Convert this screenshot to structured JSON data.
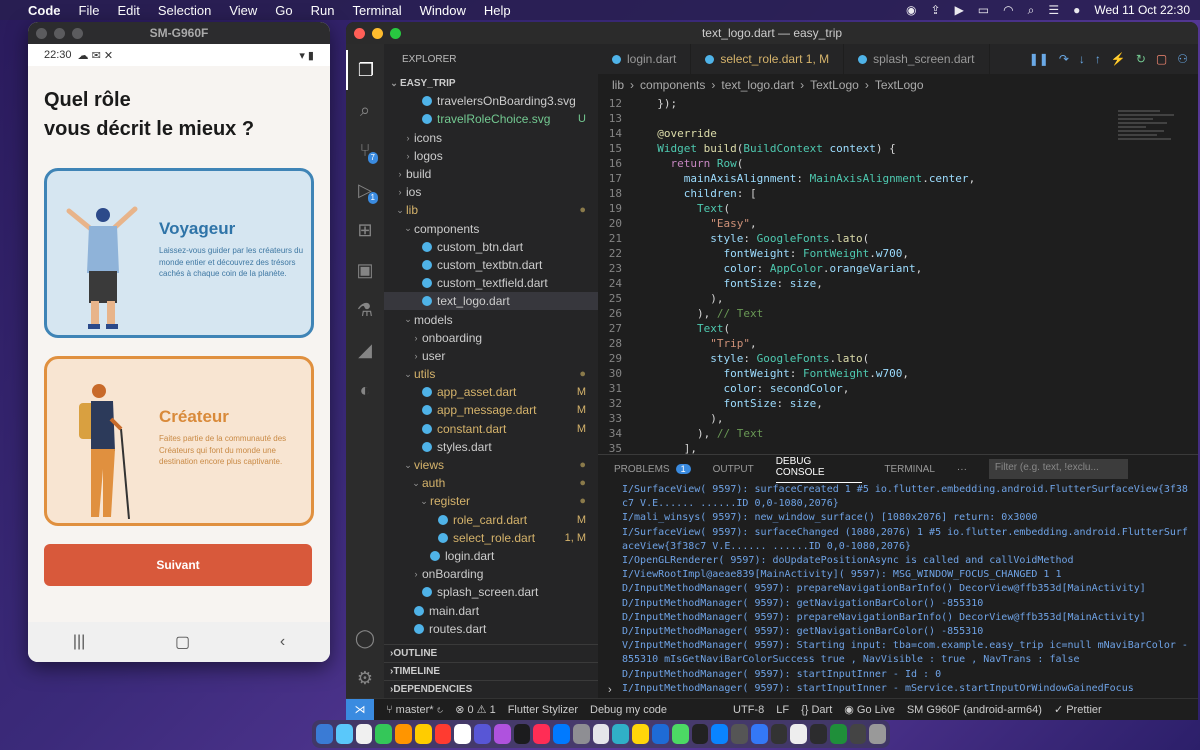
{
  "menubar": {
    "apple": "",
    "app": "Code",
    "items": [
      "File",
      "Edit",
      "Selection",
      "View",
      "Go",
      "Run",
      "Terminal",
      "Window",
      "Help"
    ],
    "clock": "Wed 11 Oct  22:30"
  },
  "phone": {
    "window_title": "SM-G960F",
    "status_time": "22:30",
    "status_icons": "☁ ✉ ✕",
    "status_right": "▾ ▮",
    "heading_line1": "Quel rôle",
    "heading_line2": "vous décrit le mieux ?",
    "card1": {
      "title": "Voyageur",
      "desc": "Laissez-vous guider par les créateurs du monde entier et découvrez des trésors cachés à chaque coin de la planète."
    },
    "card2": {
      "title": "Créateur",
      "desc": "Faites partie de la communauté des Créateurs qui font du monde une destination encore plus captivante."
    },
    "next_button": "Suivant",
    "nav": {
      "recents": "|||",
      "home": "▢",
      "back": "‹"
    }
  },
  "vscode": {
    "window_title": "text_logo.dart — easy_trip",
    "activity_badges": {
      "scm": "7",
      "debug": "1"
    },
    "explorer": {
      "header": "EXPLORER",
      "root": "EASY_TRIP",
      "tree": [
        {
          "label": "travelersOnBoarding3.svg",
          "indent": 2,
          "type": "file",
          "status": ""
        },
        {
          "label": "travelRoleChoice.svg",
          "indent": 2,
          "type": "file",
          "status": "U",
          "cls": "untr"
        },
        {
          "label": "icons",
          "indent": 1,
          "type": "folder",
          "status": ""
        },
        {
          "label": "logos",
          "indent": 1,
          "type": "folder",
          "status": ""
        },
        {
          "label": "build",
          "indent": 0,
          "type": "folder",
          "status": ""
        },
        {
          "label": "ios",
          "indent": 0,
          "type": "folder",
          "status": ""
        },
        {
          "label": "lib",
          "indent": 0,
          "type": "folder-open",
          "status": "●",
          "cls": "mod"
        },
        {
          "label": "components",
          "indent": 1,
          "type": "folder-open",
          "status": ""
        },
        {
          "label": "custom_btn.dart",
          "indent": 2,
          "type": "file",
          "status": ""
        },
        {
          "label": "custom_textbtn.dart",
          "indent": 2,
          "type": "file",
          "status": ""
        },
        {
          "label": "custom_textfield.dart",
          "indent": 2,
          "type": "file",
          "status": ""
        },
        {
          "label": "text_logo.dart",
          "indent": 2,
          "type": "file",
          "status": "",
          "sel": true
        },
        {
          "label": "models",
          "indent": 1,
          "type": "folder-open",
          "status": ""
        },
        {
          "label": "onboarding",
          "indent": 2,
          "type": "folder",
          "status": ""
        },
        {
          "label": "user",
          "indent": 2,
          "type": "folder",
          "status": ""
        },
        {
          "label": "utils",
          "indent": 1,
          "type": "folder-open",
          "status": "●",
          "cls": "mod"
        },
        {
          "label": "app_asset.dart",
          "indent": 2,
          "type": "file",
          "status": "M",
          "cls": "mod"
        },
        {
          "label": "app_message.dart",
          "indent": 2,
          "type": "file",
          "status": "M",
          "cls": "mod"
        },
        {
          "label": "constant.dart",
          "indent": 2,
          "type": "file",
          "status": "M",
          "cls": "mod"
        },
        {
          "label": "styles.dart",
          "indent": 2,
          "type": "file",
          "status": ""
        },
        {
          "label": "views",
          "indent": 1,
          "type": "folder-open",
          "status": "●",
          "cls": "mod"
        },
        {
          "label": "auth",
          "indent": 2,
          "type": "folder-open",
          "status": "●",
          "cls": "mod"
        },
        {
          "label": "register",
          "indent": 3,
          "type": "folder-open",
          "status": "●",
          "cls": "mod"
        },
        {
          "label": "role_card.dart",
          "indent": 4,
          "type": "file",
          "status": "M",
          "cls": "mod"
        },
        {
          "label": "select_role.dart",
          "indent": 4,
          "type": "file",
          "status": "1, M",
          "cls": "mod"
        },
        {
          "label": "login.dart",
          "indent": 3,
          "type": "file",
          "status": ""
        },
        {
          "label": "onBoarding",
          "indent": 2,
          "type": "folder",
          "status": ""
        },
        {
          "label": "splash_screen.dart",
          "indent": 2,
          "type": "file",
          "status": ""
        },
        {
          "label": "main.dart",
          "indent": 1,
          "type": "file",
          "status": ""
        },
        {
          "label": "routes.dart",
          "indent": 1,
          "type": "file",
          "status": ""
        }
      ],
      "sections": [
        "OUTLINE",
        "TIMELINE",
        "DEPENDENCIES"
      ]
    },
    "tabs": [
      {
        "label": "login.dart",
        "active": false,
        "extra": ""
      },
      {
        "label": "select_role.dart",
        "active": false,
        "extra": "1, M"
      },
      {
        "label": "splash_screen.dart",
        "active": false,
        "extra": ""
      }
    ],
    "breadcrumb": [
      "lib",
      "components",
      "text_logo.dart",
      "TextLogo",
      "TextLogo"
    ],
    "code": [
      {
        "n": "12",
        "html": "  });"
      },
      {
        "n": "13",
        "html": ""
      },
      {
        "n": "14",
        "html": "  <span class='f'>@override</span>"
      },
      {
        "n": "15",
        "html": "  <span class='ty'>Widget</span> <span class='f'>build</span>(<span class='ty'>BuildContext</span> <span class='p'>context</span>) {"
      },
      {
        "n": "16",
        "html": "    <span class='k2'>return</span> <span class='ty'>Row</span>("
      },
      {
        "n": "17",
        "html": "      <span class='p'>mainAxisAlignment</span>: <span class='ty'>MainAxisAlignment</span>.<span class='p'>center</span>,"
      },
      {
        "n": "18",
        "html": "      <span class='p'>children</span>: ["
      },
      {
        "n": "19",
        "html": "        <span class='ty'>Text</span>("
      },
      {
        "n": "20",
        "html": "          <span class='s'>\"Easy\"</span>,"
      },
      {
        "n": "21",
        "html": "          <span class='p'>style</span>: <span class='ty'>GoogleFonts</span>.<span class='f'>lato</span>("
      },
      {
        "n": "22",
        "html": "            <span class='p'>fontWeight</span>: <span class='ty'>FontWeight</span>.<span class='p'>w700</span>,"
      },
      {
        "n": "23",
        "html": "            <span class='p'>color</span>: <span class='ty'>AppColor</span>.<span class='p'>orangeVariant</span>,"
      },
      {
        "n": "24",
        "html": "            <span class='p'>fontSize</span>: <span class='p'>size</span>,"
      },
      {
        "n": "25",
        "html": "          ),"
      },
      {
        "n": "26",
        "html": "        ), <span class='c'>// Text</span>"
      },
      {
        "n": "27",
        "html": "        <span class='ty'>Text</span>("
      },
      {
        "n": "28",
        "html": "          <span class='s'>\"Trip\"</span>,"
      },
      {
        "n": "29",
        "html": "          <span class='p'>style</span>: <span class='ty'>GoogleFonts</span>.<span class='f'>lato</span>("
      },
      {
        "n": "30",
        "html": "            <span class='p'>fontWeight</span>: <span class='ty'>FontWeight</span>.<span class='p'>w700</span>,"
      },
      {
        "n": "31",
        "html": "            <span class='p'>color</span>: <span class='p'>secondColor</span>,"
      },
      {
        "n": "32",
        "html": "            <span class='p'>fontSize</span>: <span class='p'>size</span>,"
      },
      {
        "n": "33",
        "html": "          ),"
      },
      {
        "n": "34",
        "html": "        ), <span class='c'>// Text</span>"
      },
      {
        "n": "35",
        "html": "      ],"
      }
    ],
    "panel": {
      "tabs": [
        "PROBLEMS",
        "OUTPUT",
        "DEBUG CONSOLE",
        "TERMINAL",
        "···"
      ],
      "problems_count": "1",
      "filter_placeholder": "Filter (e.g. text, !exclu...",
      "log": [
        "I/SurfaceView( 9597): surfaceCreated 1 #5 io.flutter.embedding.android.FlutterSurfaceView{3f38",
        "c7 V.E...... ......ID 0,0-1080,2076}",
        "I/mali_winsys( 9597): new_window_surface() [1080x2076] return: 0x3000",
        "I/SurfaceView( 9597): surfaceChanged (1080,2076) 1 #5 io.flutter.embedding.android.FlutterSurf",
        "aceView{3f38c7 V.E...... ......ID 0,0-1080,2076}",
        "I/OpenGLRenderer( 9597): doUpdatePositionAsync is called and callVoidMethod",
        "I/ViewRootImpl@aeae839[MainActivity]( 9597): MSG_WINDOW_FOCUS_CHANGED 1 1",
        "D/InputMethodManager( 9597): prepareNavigationBarInfo() DecorView@ffb353d[MainActivity]",
        "D/InputMethodManager( 9597): getNavigationBarColor() -855310",
        "D/InputMethodManager( 9597): prepareNavigationBarInfo() DecorView@ffb353d[MainActivity]",
        "D/InputMethodManager( 9597): getNavigationBarColor() -855310",
        "V/InputMethodManager( 9597): Starting input: tba=com.example.easy_trip ic=null mNaviBarColor -",
        "855310 mIsGetNaviBarColorSuccess true , NavVisible : true , NavTrans : false",
        "D/InputMethodManager( 9597): startInputInner - Id : 0",
        "I/InputMethodManager( 9597): startInputInner - mService.startInputOrWindowGainedFocus"
      ],
      "prompt": "›"
    },
    "status": {
      "branch": "master*",
      "errors": "⊗ 0 ⚠ 1",
      "flutter_stylizer": "Flutter Stylizer",
      "debug": "Debug my code",
      "encoding": "UTF-8",
      "eol": "LF",
      "lang": "{} Dart",
      "golive": "Go Live",
      "device": "SM G960F (android-arm64)",
      "prettier": "✓ Prettier"
    }
  }
}
